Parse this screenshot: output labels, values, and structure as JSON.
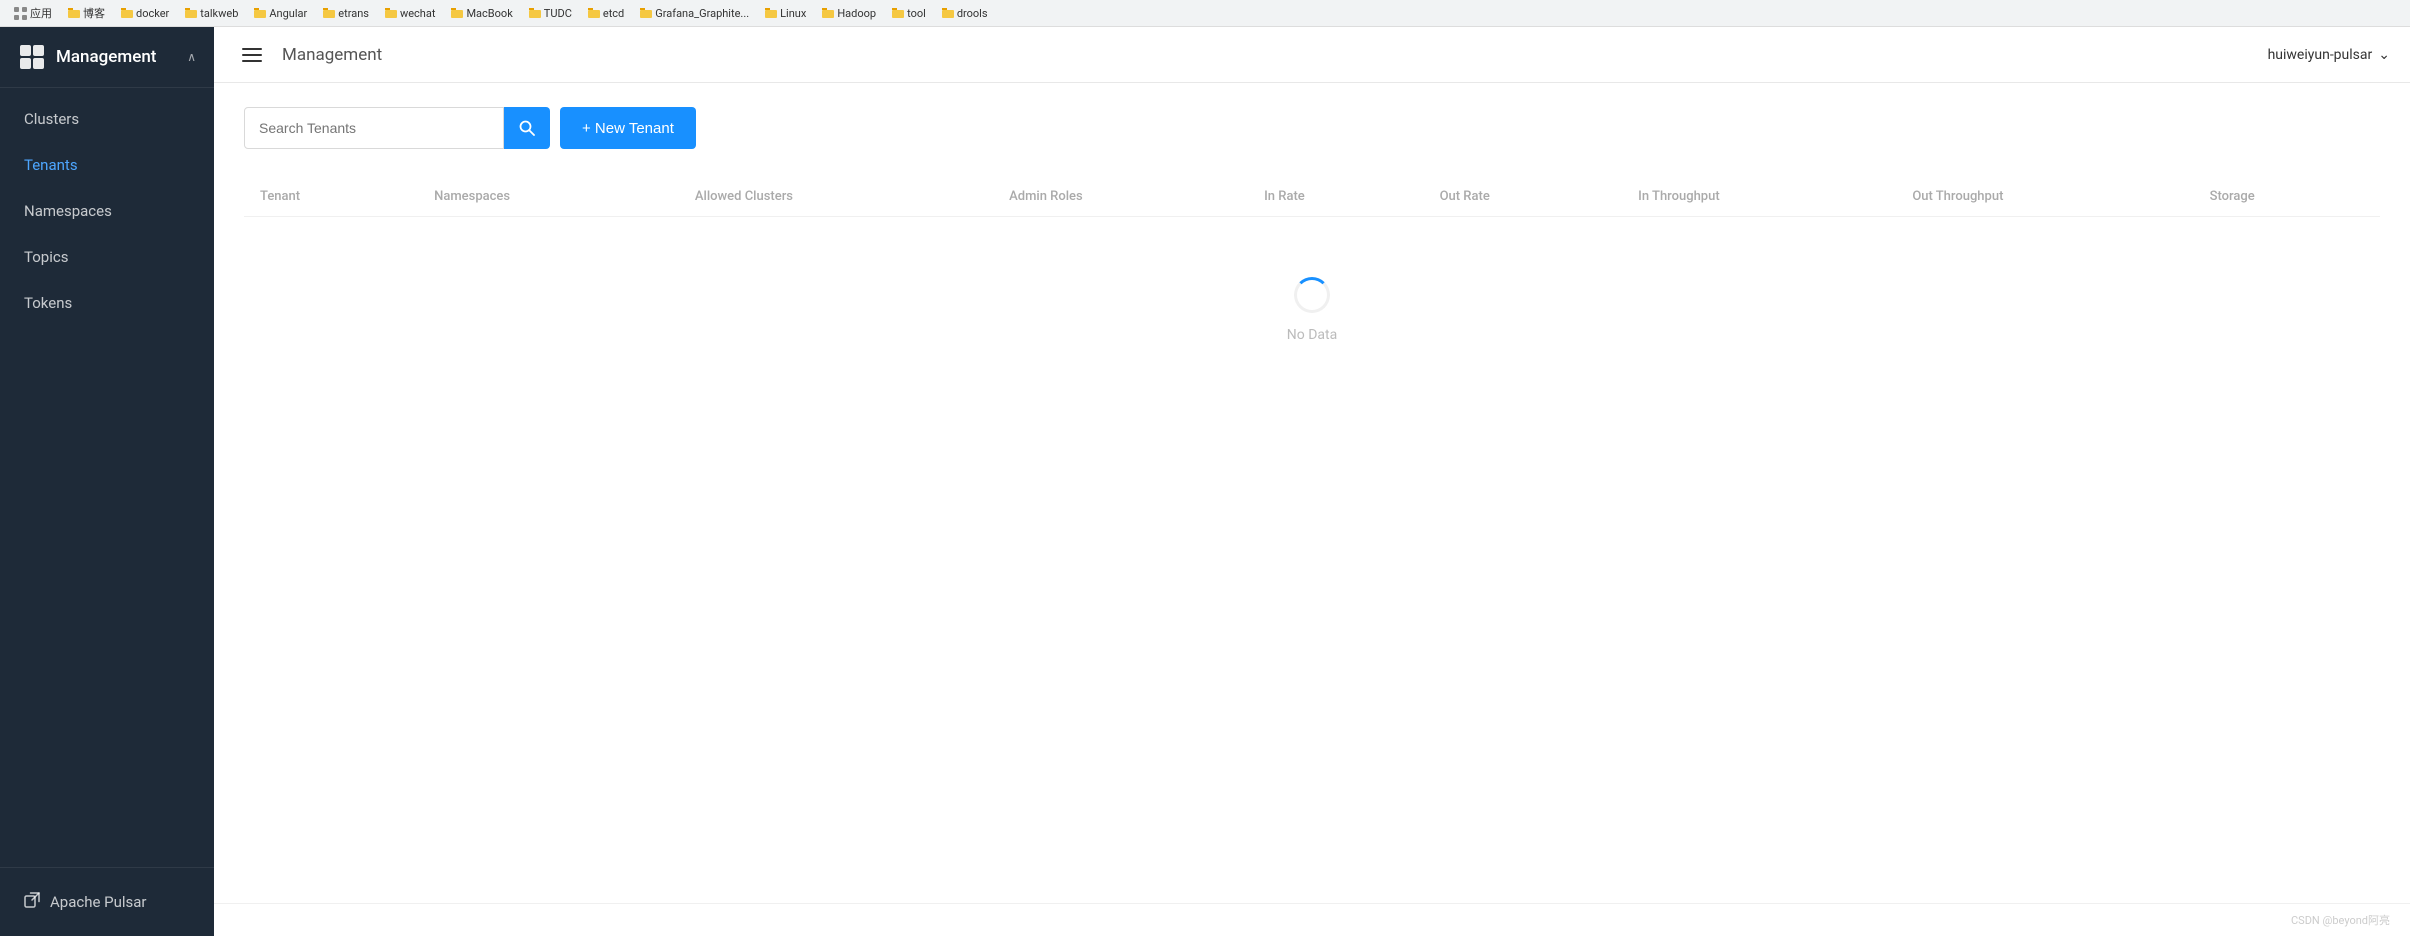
{
  "bookmarks": {
    "items": [
      {
        "label": "应用",
        "type": "apps"
      },
      {
        "label": "博客",
        "type": "folder"
      },
      {
        "label": "docker",
        "type": "folder"
      },
      {
        "label": "talkweb",
        "type": "folder"
      },
      {
        "label": "Angular",
        "type": "folder"
      },
      {
        "label": "etrans",
        "type": "folder"
      },
      {
        "label": "wechat",
        "type": "folder"
      },
      {
        "label": "MacBook",
        "type": "folder"
      },
      {
        "label": "TUDC",
        "type": "folder"
      },
      {
        "label": "etcd",
        "type": "folder"
      },
      {
        "label": "Grafana_Graphite...",
        "type": "folder"
      },
      {
        "label": "Linux",
        "type": "folder"
      },
      {
        "label": "Hadoop",
        "type": "folder"
      },
      {
        "label": "tool",
        "type": "folder"
      },
      {
        "label": "drools",
        "type": "folder"
      }
    ]
  },
  "sidebar": {
    "logo_label": "M",
    "title": "Management",
    "chevron": "∧",
    "items": [
      {
        "id": "clusters",
        "label": "Clusters",
        "active": false
      },
      {
        "id": "tenants",
        "label": "Tenants",
        "active": true
      },
      {
        "id": "namespaces",
        "label": "Namespaces",
        "active": false
      },
      {
        "id": "topics",
        "label": "Topics",
        "active": false
      },
      {
        "id": "tokens",
        "label": "Tokens",
        "active": false
      }
    ],
    "external_link": {
      "label": "Apache Pulsar",
      "icon": "↗"
    }
  },
  "header": {
    "title": "Management",
    "user": "huiweiyun-pulsar",
    "user_chevron": "⌄"
  },
  "toolbar": {
    "search_placeholder": "Search Tenants",
    "search_icon": "🔍",
    "new_tenant_label": "+ New Tenant"
  },
  "table": {
    "columns": [
      {
        "id": "tenant",
        "label": "Tenant"
      },
      {
        "id": "namespaces",
        "label": "Namespaces"
      },
      {
        "id": "allowed_clusters",
        "label": "Allowed Clusters"
      },
      {
        "id": "admin_roles",
        "label": "Admin Roles"
      },
      {
        "id": "in_rate",
        "label": "In Rate"
      },
      {
        "id": "out_rate",
        "label": "Out Rate"
      },
      {
        "id": "in_throughput",
        "label": "In Throughput"
      },
      {
        "id": "out_throughput",
        "label": "Out Throughput"
      },
      {
        "id": "storage",
        "label": "Storage"
      }
    ],
    "rows": [],
    "loading": true,
    "no_data_text": "No Data"
  },
  "footer": {
    "text": "CSDN @beyond阿亮"
  }
}
